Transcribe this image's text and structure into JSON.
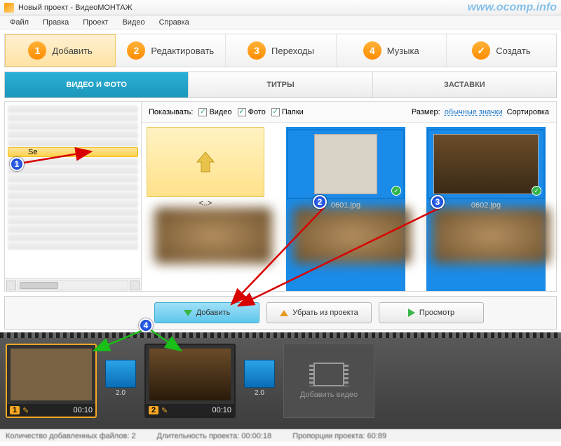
{
  "window": {
    "title": "Новый проект - ВидеоМОНТАЖ"
  },
  "menu": [
    "Файл",
    "Правка",
    "Проект",
    "Видео",
    "Справка"
  ],
  "steps": [
    {
      "num": "1",
      "label": "Добавить",
      "active": true
    },
    {
      "num": "2",
      "label": "Редактировать"
    },
    {
      "num": "3",
      "label": "Переходы"
    },
    {
      "num": "4",
      "label": "Музыка"
    },
    {
      "num": "✓",
      "label": "Создать"
    }
  ],
  "subtabs": {
    "video_photo": "ВИДЕО И ФОТО",
    "titles": "ТИТРЫ",
    "intros": "ЗАСТАВКИ"
  },
  "tree": {
    "selected": "Se"
  },
  "filter": {
    "show": "Показывать:",
    "video": "Видео",
    "photo": "Фото",
    "folders": "Папки",
    "size": "Размер:",
    "size_value": "обычные значки",
    "sort": "Сортировка"
  },
  "gallery": {
    "parent": "<..>",
    "items": [
      {
        "name": "0601.jpg"
      },
      {
        "name": "0602.jpg"
      }
    ]
  },
  "actions": {
    "add": "Добавить",
    "remove": "Убрать из проекта",
    "preview": "Просмотр"
  },
  "timeline": {
    "clips": [
      {
        "num": "1",
        "time": "00:10"
      },
      {
        "num": "2",
        "time": "00:10"
      }
    ],
    "trans_dur": "2.0",
    "add_video": "Добавить видео"
  },
  "status": {
    "files": "Количество добавленных файлов: 2",
    "duration": "Длительность проекта:  00:00:18",
    "proportions": "Пропорции проекта:  60:89"
  },
  "markers": {
    "m1": "1",
    "m2": "2",
    "m3": "3",
    "m4": "4"
  },
  "watermark": "www.ocomp.info"
}
